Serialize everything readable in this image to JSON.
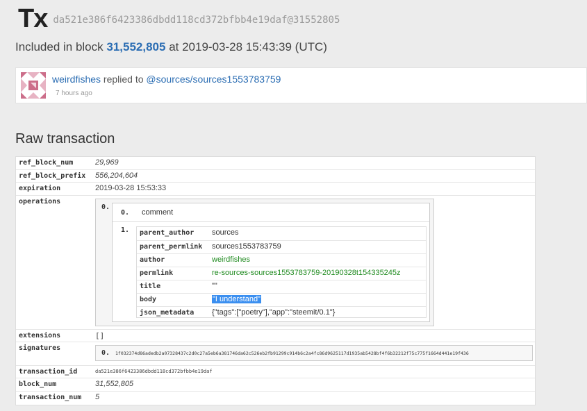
{
  "header": {
    "title": "Tx",
    "tx_ref": "da521e386f6423386dbdd118cd372bfbb4e19daf@31552805"
  },
  "included": {
    "prefix": "Included in block",
    "block": "31,552,805",
    "middle": "at 2019-03-28 15:43:39 (UTC)"
  },
  "reply_card": {
    "author": "weirdfishes",
    "action": "replied to",
    "target": "@sources/sources1553783759",
    "time_ago": "7 hours ago"
  },
  "section_title": "Raw transaction",
  "raw": {
    "ref_block_num": {
      "key": "ref_block_num",
      "value": "29,969"
    },
    "ref_block_prefix": {
      "key": "ref_block_prefix",
      "value": "556,204,604"
    },
    "expiration": {
      "key": "expiration",
      "value": "2019-03-28 15:53:33"
    },
    "operations": {
      "key": "operations",
      "index0": "0.",
      "op_index": "0.",
      "op_type": "comment",
      "body_index": "1.",
      "fields": [
        {
          "key": "parent_author",
          "value": "sources"
        },
        {
          "key": "parent_permlink",
          "value": "sources1553783759"
        },
        {
          "key": "author",
          "value": "weirdfishes"
        },
        {
          "key": "permlink",
          "value": "re-sources-sources1553783759-20190328t154335245z"
        },
        {
          "key": "title",
          "value": "\"\""
        },
        {
          "key": "body",
          "value": "\"I understand\""
        },
        {
          "key": "json_metadata",
          "value": "{\"tags\":[\"poetry\"],\"app\":\"steemit/0.1\"}"
        }
      ]
    },
    "extensions": {
      "key": "extensions",
      "value": "[]"
    },
    "signatures": {
      "key": "signatures",
      "index": "0.",
      "value": "1f032374d86adedb2a07328437c2d0c27a5eb6a381746da62c526eb2fb91299c914b6c2a4fc86d9625117d1935ab5428bf4f6b32212f75c775f1664d441e19f436"
    },
    "transaction_id": {
      "key": "transaction_id",
      "value": "da521e386f6423386dbdd118cd372bfbb4e19daf"
    },
    "block_num": {
      "key": "block_num",
      "value": "31,552,805"
    },
    "transaction_num": {
      "key": "transaction_num",
      "value": "5"
    }
  },
  "colors": {
    "link": "#2b6db3",
    "green_value": "#1f8a1f",
    "selection": "#3b8ff0"
  }
}
